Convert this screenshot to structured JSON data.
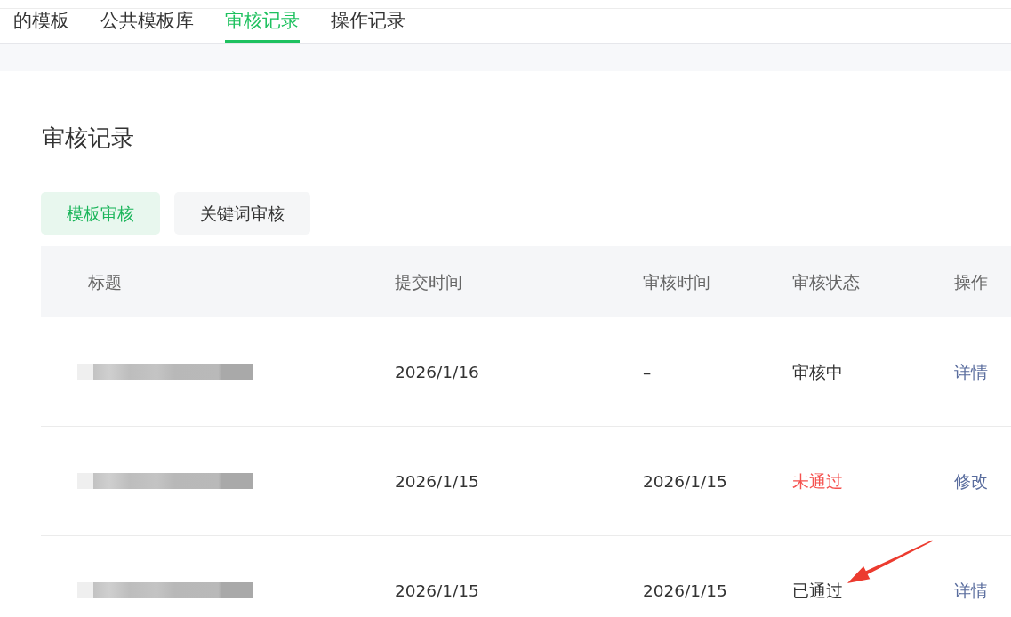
{
  "tabs": [
    {
      "label": "的模板",
      "selected": false
    },
    {
      "label": "公共模板库",
      "selected": false
    },
    {
      "label": "审核记录",
      "selected": true
    },
    {
      "label": "操作记录",
      "selected": false
    }
  ],
  "page_title": "审核记录",
  "segments": [
    {
      "label": "模板审核",
      "selected": true
    },
    {
      "label": "关键词审核",
      "selected": false
    }
  ],
  "table": {
    "columns": [
      "标题",
      "提交时间",
      "审核时间",
      "审核状态",
      "操作"
    ],
    "rows": [
      {
        "submitted": "2026/1/16",
        "reviewed": "–",
        "status": {
          "text": "审核中",
          "color": "#333333"
        },
        "action": "详情"
      },
      {
        "submitted": "2026/1/15",
        "reviewed": "2026/1/15",
        "status": {
          "text": "未通过",
          "color": "#f5524f"
        },
        "action": "修改"
      },
      {
        "submitted": "2026/1/15",
        "reviewed": "2026/1/15",
        "status": {
          "text": "已通过",
          "color": "#333333"
        },
        "action": "详情"
      }
    ]
  }
}
